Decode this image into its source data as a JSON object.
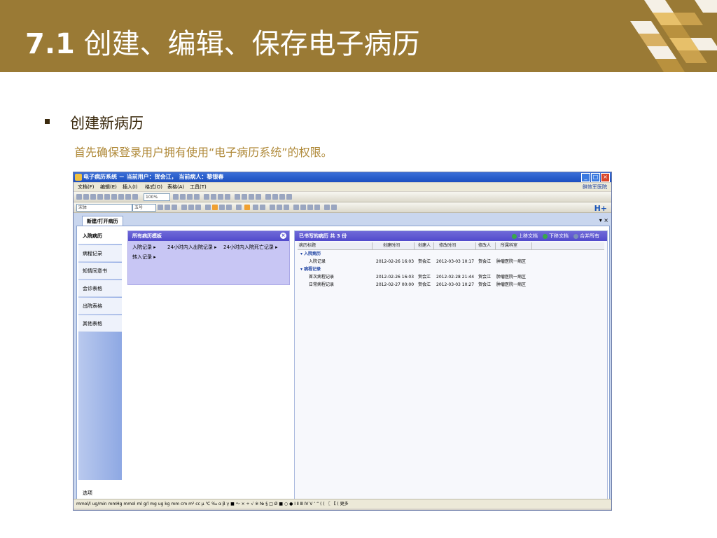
{
  "slide": {
    "title_number": "7.1",
    "title_text": "创建、编辑、保存电子病历",
    "bullet_title": "创建新病历",
    "bullet_sub": "首先确保登录用户拥有使用“电子病历系统”的权限。"
  },
  "app": {
    "window_title": "电子病历系统 － 当前用户：贺会江， 当前病人：黎银春",
    "menu": [
      "文档(F)",
      "编辑(E)",
      "插入(I)",
      "格式(O)",
      "表格(A)",
      "工具(T)"
    ],
    "menu_right": "鲜效军医院",
    "zoom": "100%",
    "font_name": "宋体",
    "font_size": "五号",
    "logo": "H+",
    "doc_tab": "新建/打开病历",
    "doc_tab_ctrl": "▾ ×",
    "nav_items": [
      "入院病历",
      "病程记录",
      "知情同意书",
      "会诊表格",
      "出院表格",
      "其他表格"
    ],
    "nav_options": "选项",
    "template_panel": {
      "title": "所有病历模板",
      "close": "×",
      "items": [
        "入院记录 ▸",
        "24小时内入出院记录 ▸",
        "24小时内入院死亡记录 ▸",
        "转入记录 ▸"
      ]
    },
    "records_panel": {
      "title": "已书写的病历",
      "count": "共 3 份",
      "actions": [
        "上移文档",
        "下移文档",
        "合并所有"
      ],
      "columns": [
        "病历标题",
        "创建时间",
        "创建人",
        "修改时间",
        "修改人",
        "所属科室"
      ],
      "groups": [
        {
          "name": "入院病历",
          "rows": [
            [
              "入院记录",
              "2012-02-26 16:03",
              "贺会江",
              "2012-03-03 10:17",
              "贺会江",
              "肿瘤医院一病区"
            ]
          ]
        },
        {
          "name": "病程记录",
          "rows": [
            [
              "首次病程记录",
              "2012-02-26 16:03",
              "贺会江",
              "2012-02-28 21:44",
              "贺会江",
              "肿瘤医院一病区"
            ],
            [
              "日常病程记录",
              "2012-02-27 00:00",
              "贺会江",
              "2012-03-03 10:27",
              "贺会江",
              "肿瘤医院一病区"
            ]
          ]
        }
      ]
    },
    "symbol_bar": "mmol/l  ug/min  mmHg  mmol  ml  g/l  mg  ug  kg  mm  cm  m²  cc  μ  ℃  ‰  α  β  γ  ■  ～  ×  ÷  √  ※  №  §  □  Ø  ■  ○  ●  Ⅰ  Ⅱ  Ⅲ  Ⅳ  Ⅴ  ‘  “  (  (  〖  【  (  更多"
  },
  "colors": {
    "header_bg": "#9a7a35",
    "accent_blue": "#524bcc",
    "panel_purple": "#c8c6f4"
  }
}
